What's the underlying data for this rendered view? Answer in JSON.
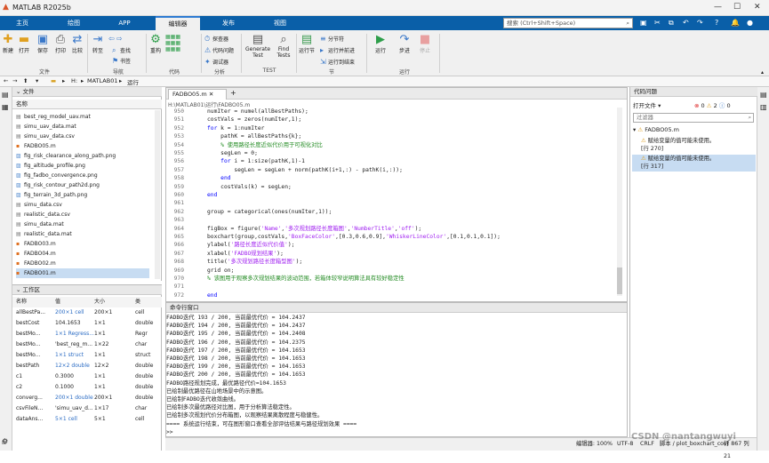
{
  "window": {
    "title": "MATLAB R2025b"
  },
  "tabs": [
    "主页",
    "绘图",
    "APP",
    "编辑器",
    "发布",
    "视图"
  ],
  "search": {
    "placeholder": "搜索 (Ctrl+Shift+Space)"
  },
  "ribbon": {
    "file": {
      "new": "新建",
      "open": "打开",
      "save": "保存",
      "print": "打印",
      "compare": "比较",
      "group": "文件"
    },
    "nav": {
      "goto": "转至",
      "find": "查找",
      "bookmark": "书签",
      "group": "导航"
    },
    "code": {
      "refactor": "重构",
      "group": "代码"
    },
    "analyze": {
      "profiler": "探查器",
      "code_issues": "代码问题",
      "debugger": "调试器",
      "group": "分析"
    },
    "test": {
      "generate": "Generate",
      "generate2": "Test",
      "find": "Find",
      "find2": "Tests",
      "group": "TEST"
    },
    "section": {
      "run_section": "运行节",
      "section_break": "分节符",
      "run_advance": "运行并前进",
      "run_to_end": "运行到结束",
      "group": "节"
    },
    "run": {
      "run": "运行",
      "step": "步进",
      "stop": "停止",
      "group": "运行"
    }
  },
  "address": {
    "drive": "H:",
    "folder1": "MATLAB01",
    "folder2": "运行"
  },
  "files_panel": {
    "title": "文件",
    "col_name": "名称",
    "items": [
      "best_reg_model_uav.mat",
      "simu_uav_data.mat",
      "simu_uav_data.csv",
      "FADBO05.m",
      "fig_risk_clearance_along_path.png",
      "fig_altitude_profile.png",
      "fig_fadbo_convergence.png",
      "fig_risk_contour_path2d.png",
      "fig_terrain_3d_path.png",
      "simu_data.csv",
      "realistic_data.csv",
      "simu_data.mat",
      "realistic_data.mat",
      "FADBO03.m",
      "FADBO04.m",
      "FADBO02.m",
      "FADBO01.m"
    ]
  },
  "workspace": {
    "title": "工作区",
    "cols": [
      "名称",
      "值",
      "大小",
      "类"
    ],
    "rows": [
      [
        "allBestPa...",
        "200×1 cell",
        "200×1",
        "cell"
      ],
      [
        "bestCost",
        "104.1653",
        "1×1",
        "double"
      ],
      [
        "bestMo...",
        "1×1 Regress...",
        "1×1",
        "Regr"
      ],
      [
        "bestMo...",
        "'best_reg_m...",
        "1×22",
        "char"
      ],
      [
        "bestMo...",
        "1×1 struct",
        "1×1",
        "struct"
      ],
      [
        "bestPath",
        "12×2 double",
        "12×2",
        "double"
      ],
      [
        "c1",
        "0.3000",
        "1×1",
        "double"
      ],
      [
        "c2",
        "0.1000",
        "1×1",
        "double"
      ],
      [
        "converg...",
        "200×1 double",
        "200×1",
        "double"
      ],
      [
        "csvFileN...",
        "'simu_uav_d...",
        "1×17",
        "char"
      ],
      [
        "dataAns...",
        "5×1 cell",
        "5×1",
        "cell"
      ]
    ]
  },
  "editor": {
    "tab": "FADBO05.m",
    "path": "H:\\MATLAB01\\运行\\FADBO05.m",
    "lines": [
      {
        "n": "950",
        "c": "numIter = numel(allBestPaths);"
      },
      {
        "n": "951",
        "c": "costVals = zeros(numIter,1);"
      },
      {
        "n": "952",
        "c": "for k = 1:numIter",
        "kw": true
      },
      {
        "n": "953",
        "c": "    pathK = allBestPaths{k};"
      },
      {
        "n": "954",
        "c": "    % 使用路径长度近似代价用于可视化对比",
        "cm": true
      },
      {
        "n": "955",
        "c": "    segLen = 0;"
      },
      {
        "n": "956",
        "c": "    for i = 1:size(pathK,1)-1",
        "kw": true
      },
      {
        "n": "957",
        "c": "        segLen = segLen + norm(pathK(i+1,:) - pathK(i,:));"
      },
      {
        "n": "958",
        "c": "    end",
        "kw": true
      },
      {
        "n": "959",
        "c": "    costVals(k) = segLen;"
      },
      {
        "n": "960",
        "c": "end",
        "kw": true
      },
      {
        "n": "961",
        "c": ""
      },
      {
        "n": "962",
        "c": "group = categorical(ones(numIter,1));"
      },
      {
        "n": "963",
        "c": ""
      },
      {
        "n": "964",
        "c": "figBox = figure('Name','多次规划路径长度箱图','NumberTitle','off');"
      },
      {
        "n": "965",
        "c": "boxchart(group,costVals,'BoxFaceColor',[0.3,0.6,0.9],'WhiskerLineColor',[0.1,0.1,0.1]);"
      },
      {
        "n": "966",
        "c": "ylabel('路径长度近似代价值');"
      },
      {
        "n": "967",
        "c": "xlabel('FADBO规划结果');"
      },
      {
        "n": "968",
        "c": "title('多次规划路径长度箱型图');"
      },
      {
        "n": "969",
        "c": "grid on;"
      },
      {
        "n": "970",
        "c": "% 该图用于观察多次规划结果的波动范围，若箱体较窄说明算法具有较好稳定性",
        "cm": true
      },
      {
        "n": "971",
        "c": ""
      },
      {
        "n": "972",
        "c": "end",
        "kw": true
      }
    ]
  },
  "command_window": {
    "title": "命令行窗口",
    "lines": [
      "FADBO迭代 193 / 200, 当前最优代价 = 104.2437",
      "FADBO迭代 194 / 200, 当前最优代价 = 104.2437",
      "FADBO迭代 195 / 200, 当前最优代价 = 104.2408",
      "FADBO迭代 196 / 200, 当前最优代价 = 104.2375",
      "FADBO迭代 197 / 200, 当前最优代价 = 104.1653",
      "FADBO迭代 198 / 200, 当前最优代价 = 104.1653",
      "FADBO迭代 199 / 200, 当前最优代价 = 104.1653",
      "FADBO迭代 200 / 200, 当前最优代价 = 104.1653",
      "FADBO路径规划完成，最优路径代价=104.1653",
      "已绘制最优路径在山地场景中的示意图。",
      "已绘制FADBO迭代收敛曲线。",
      "已绘制多次最优路径对比图，用于分析算法稳定性。",
      "已绘制多次规划代价分布箱图，以观察结果离散程度与稳健性。",
      "==== 系统运行结束，可在图形窗口查看全部评估结果与路径规划效果 ====",
      ">>"
    ]
  },
  "issues": {
    "title": "代码问题",
    "open_files": "打开文件",
    "counts": {
      "err": "0",
      "warn": "2",
      "info": "0"
    },
    "filter_placeholder": "过滤器",
    "file": "FADBO05.m",
    "items": [
      {
        "text": "赋给变量的值可能未使用。",
        "loc": "[行 270]"
      },
      {
        "text": "赋给变量的值可能未使用。",
        "loc": "[行 317]"
      }
    ]
  },
  "status": {
    "zoom": "编辑器: 100%",
    "encoding": "UTF-8",
    "eol": "CRLF",
    "script": "脚本 / plot_boxchart_cost",
    "pos": "行 867 列 21"
  },
  "watermark": "CSDN @nantangwuyi"
}
